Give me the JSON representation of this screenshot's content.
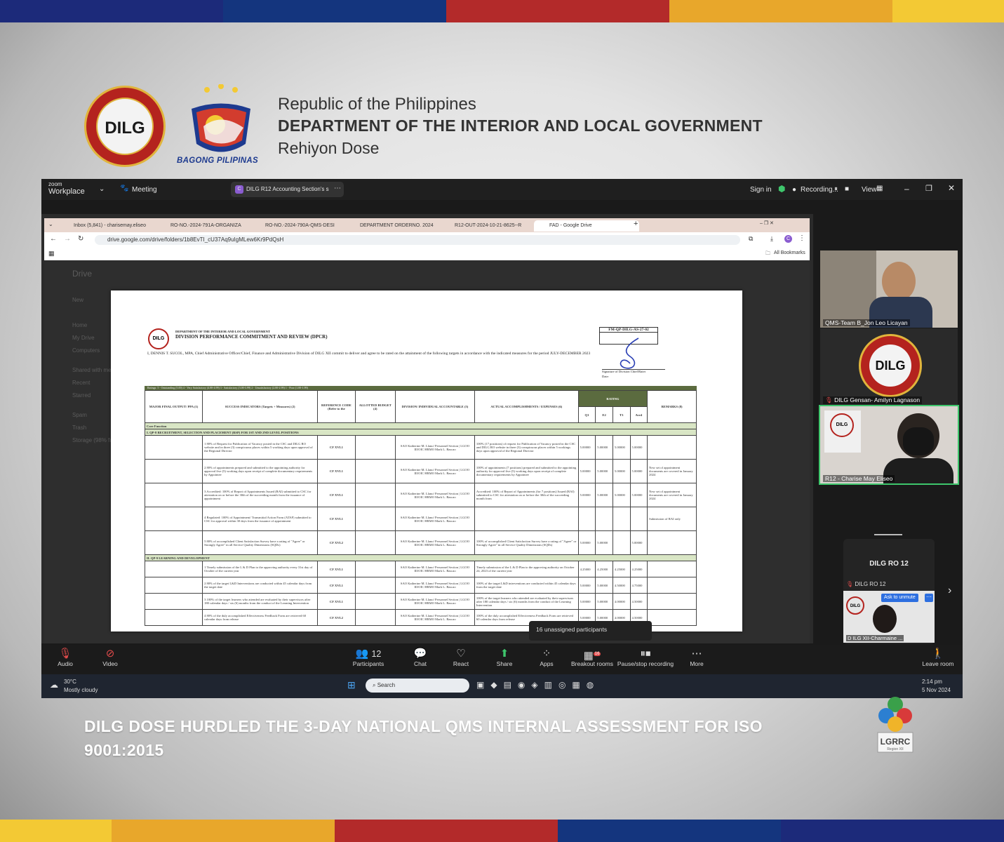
{
  "colors": {
    "stripe": [
      "#1c2a7a",
      "#1c2a7a",
      "#14357e",
      "#14357e",
      "#b32a2a",
      "#b32a2a",
      "#e8a72b",
      "#e8a72b",
      "#f3c934"
    ],
    "zoom_bg": "#1a1a1a",
    "speaking_border": "#3ec66c",
    "recording_dot": "#e0e0e0"
  },
  "header": {
    "seal_word": "DILG",
    "bagong_label": "BAGONG PILIPINAS",
    "line1": "Republic of the Philippines",
    "line2": "DEPARTMENT OF THE INTERIOR AND LOCAL GOVERNMENT",
    "line3": "Rehiyon Dose"
  },
  "zoom": {
    "brand_top": "zoom",
    "brand": "Workplace",
    "meeting_label": "Meeting",
    "share_pill": "DILG R12 Accounting Section's s",
    "sign_in": "Sign in",
    "recording": "Recording...",
    "view": "View"
  },
  "browser": {
    "tabs": [
      "Inbox (5,841) - charisemay.eliseo",
      "RO-NO.-2024-791A-ORGANIZA",
      "RO-NO.-2024-790A-QMS-DESI",
      "DEPARTMENT ORDERNO. 2024",
      "R12-OUT-2024-10-21-8625--R",
      "FAD - Google Drive"
    ],
    "url": "drive.google.com/drive/folders/1b8EvTI_cU37Aq9uIgMLew6Kr9PdQsH",
    "all_bookmarks": "All Bookmarks",
    "drive_dim": [
      "Drive",
      "New",
      "Home",
      "My Drive",
      "Computers",
      "Shared with me",
      "Recent",
      "Starred",
      "Spam",
      "Trash",
      "Storage (98% full)"
    ]
  },
  "document": {
    "agency_small": "DEPARTMENT OF THE INTERIOR AND LOCAL GOVERNMENT",
    "title": "DIVISION PERFORMANCE COMMITMENT AND REVIEW (DPCR)",
    "form_code": "FM-QP-DILG-AS-27-02",
    "commit_text": "I, DENNIS T. SUCOL, MPA, Chief Administrative Officer/Chief, Finance and Administrative Division of DILG XII commit to deliver and agree to be rated on the attainment of the following targets in accordance with the indicated measures for the period JULY-DECEMBER 2023",
    "signature_label": "Signature of Division Chief/Rater",
    "date_label": "Date:",
    "ratings_line": "Ratings:   5 - Outstanding (5.00)    4 - Very Satisfactory (4.00-4.99)    3 - Satisfactory (3.00-3.99)    2 - Unsatisfactory (2.00-2.99)    1 - Poor (1.00-1.99)",
    "columns": [
      "MAJOR FINAL OUTPUT/ PPA (1)",
      "SUCCESS INDICATORS (Targets + Measures) (2)",
      "REFERENCE CODE (Refer to the",
      "ALLOTTED BUDGET (4)",
      "DIVISION/ INDIVIDUAL ACCOUNTABLE (5)",
      "ACTUAL ACCOMPLISHMENTS / EXPENSES (6)",
      "RATING",
      "REMARKS (8)"
    ],
    "rating_cols": [
      "Q1",
      "E2",
      "T3",
      "Ave4"
    ],
    "core_function": "Core Function",
    "section1": "I. QP-8 RECRUITMENT, SELECTION AND PLACEMENT (RSP) FOR 1ST AND 2ND LEVEL POSITIONS",
    "section2": "II. QP-9 LEARNING AND DEVELOPMENT",
    "rows1": [
      {
        "si": "1  80% of Request for Publication of Vacancy posted in the CSC and DILG RO website and in three (3) conspicuous places within 5 working days upon approval of the Regional Director",
        "code": "CF XVI.1",
        "acc": "SAO Katherine M. Llano/ Personnel Section | LGOO III/OIC HRMO Mark L. Bascao",
        "act": "100% (17 positions) of request for Publication of Vacancy posted in the CSC and DILG RO website in three (3) conspicuous places within 5 workings days upon approval of the Regional Director",
        "r": [
          "5.00000",
          "5.00000",
          "5.00000"
        ],
        "rem": ""
      },
      {
        "si": "2  80% of appointments prepared and submitted to the appointing authority for approval five (5) working days upon receipt of complete documentary requirements by Appointee",
        "code": "CF XVI.1",
        "acc": "SAO Katherine M. Llano/ Personnel Section | LGOO III/OIC HRMO Mark L. Bascao",
        "act": "100% of appointments (7 positions) prepared and submitted to the appointing authority for approval five (5) working days upon receipt of complete documentary requirements by Appointee",
        "r": [
          "5.00000",
          "5.00000",
          "5.00000"
        ],
        "rem": "New set of appointment documents are covered in January 2024"
      },
      {
        "si": "3  Accredited: 100% of Report of Appointments Issued (RAI) submitted to CSC for attestation on or before the 30th of the succeeding month from the issuance of appointment",
        "code": "CF XVI.1",
        "acc": "SAO Katherine M. Llano/ Personnel Section | LGOO III/OIC HRMO Mark L. Bascao",
        "act": "Accredited: 100% of Report of Appointments (for 7 positions) Issued (RAI) submitted to CSC for attestation on or before the 30th of the succeeding month from",
        "r": [
          "5.00000",
          "5.00000",
          "5.00000"
        ],
        "rem": "New set of appointment documents are covered in January 2024"
      },
      {
        "si": "4  Regulated: 100% of Appointment/ Transmittal Action Form (ATAF) submitted to CSC for approval within 30 days from the issuance of appointment",
        "code": "CF XVI.1",
        "acc": "SAO Katherine M. Llano/ Personnel Section | LGOO III/OIC HRMO Mark L. Bascao",
        "act": "",
        "r": [
          "",
          "",
          ""
        ],
        "rem": "Submission of RAI only"
      },
      {
        "si": "5  80% of accomplished Client Satisfaction Survey have a rating of \"Agree\" or Strongly Agree\" in all Service Quality Dimensions (SQDs)",
        "code": "CF XVI.2",
        "acc": "SAO Katherine M. Llano/ Personnel Section | LGOO III/OIC HRMO Mark L. Bascao",
        "act": "100% of accomplished Client Satisfaction Survey have a rating of \"Agree\" or Strongly Agree\" in all Service Quality Dimensions (SQDs)",
        "r": [
          "5.00000",
          "",
          "5.00000"
        ],
        "rem": ""
      }
    ],
    "rows2": [
      {
        "si": "1  Timely submission of the L & D Plan to the approving authority every 31st day of October of the current year",
        "code": "CF XVI.1",
        "acc": "SAO Katherine M. Llano/ Personnel Section | LGOO III/OIC HRMO Mark L. Bascao",
        "act": "Timely submission of the L & D Plan to the approving authority on October 24, 2023 of the current year",
        "r": [
          "4.25000",
          "4.25000",
          "4.25000"
        ]
      },
      {
        "si": "2  80% of the target L&D Interventions are conducted within 45 calendar days from the target date",
        "code": "CF XVI.1",
        "acc": "SAO Katherine M. Llano/ Personnel Section | LGOO III/OIC HRMO Mark L. Bascao",
        "act": "100% of the target L&D interventions are conducted within 45 calendar days from the target date",
        "r": [
          "5.00000",
          "4.50000",
          "4.75000"
        ]
      },
      {
        "si": "3  100% of the target learners who attended are evaluated by their supervisors after 180 calendar days / six (6) months from the conduct of the Learning Intervention",
        "code": "CF XVI.1",
        "acc": "SAO Katherine M. Llano/ Personnel Section | LGOO III/OIC HRMO Mark L. Bascao",
        "act": "100% of the target learners who attended are evaluated by their supervisors after 180 calendar days / six (6) months from the conduct of the Learning Intervention",
        "r": [
          "5.00000",
          "4.00000",
          "4.50000"
        ]
      },
      {
        "si": "4  80% of the duly accomplished Effectiveness Feedback Form are retrieved 60 calendar days from release",
        "code": "CF XVI.2",
        "acc": "SAO Katherine M. Llano/ Personnel Section | LGOO III/OIC HRMO Mark L. Bascao",
        "act": "100% of the duly accomplished Effectiveness Feedback Form are retrieved 60 calendar days from release",
        "r": [
          "5.00000",
          "4.00000",
          "4.50000"
        ]
      }
    ]
  },
  "participants": {
    "tile1": "QMS-Team B_Jon Leo Licayan",
    "tile2": "DILG Gensan- Amilyn Lagnason",
    "tile3": "R12 - Charise May Eliseo",
    "group_title": "DILG RO 12",
    "group_sub": "DILG RO 12",
    "ask_unmute": "Ask to unmute",
    "group_tile": "D ILG XII-Charmaine ..."
  },
  "tooltip": "16 unassigned participants",
  "toolbar": {
    "audio": "Audio",
    "video": "Video",
    "participants": "Participants",
    "participants_count": "12",
    "chat": "Chat",
    "react": "React",
    "share": "Share",
    "apps": "Apps",
    "breakout": "Breakout rooms",
    "breakout_badge": "16",
    "pause": "Pause/stop recording",
    "more": "More",
    "leave": "Leave room"
  },
  "taskbar": {
    "temp": "30°C",
    "weather": "Mostly cloudy",
    "search": "Search",
    "time": "2:14 pm",
    "date": "5 Nov 2024"
  },
  "caption": "DILG DOSE HURDLED THE 3-DAY NATIONAL QMS INTERNAL ASSESSMENT FOR ISO 9001:2015",
  "lgrrc": {
    "label": "LGRRC",
    "sub": "Region XII"
  }
}
